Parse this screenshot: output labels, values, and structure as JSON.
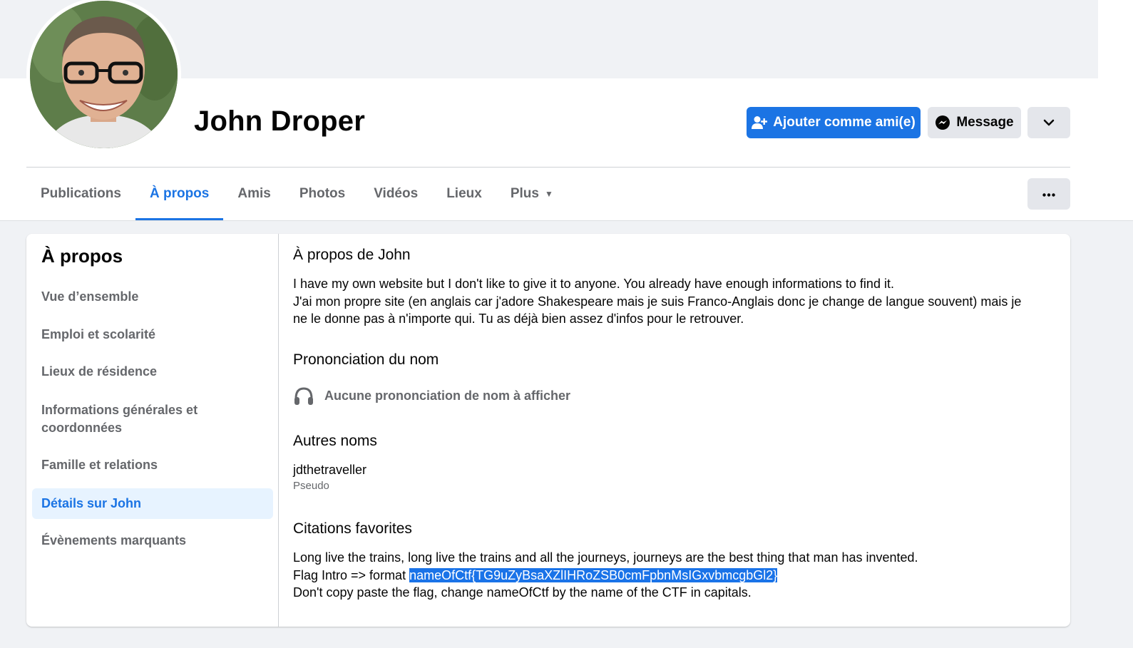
{
  "profile": {
    "name": "John Droper"
  },
  "actions": {
    "add_friend": "Ajouter comme ami(e)",
    "message": "Message"
  },
  "tabs": [
    {
      "label": "Publications"
    },
    {
      "label": "À propos"
    },
    {
      "label": "Amis"
    },
    {
      "label": "Photos"
    },
    {
      "label": "Vidéos"
    },
    {
      "label": "Lieux"
    },
    {
      "label": "Plus"
    }
  ],
  "sidebar": {
    "title": "À propos",
    "items": [
      {
        "label": "Vue d’ensemble"
      },
      {
        "label": "Emploi et scolarité"
      },
      {
        "label": "Lieux de résidence"
      },
      {
        "label": "Informations générales et coordonnées"
      },
      {
        "label": "Famille et relations"
      },
      {
        "label": "Détails sur John"
      },
      {
        "label": "Évènements marquants"
      }
    ]
  },
  "details": {
    "about_title": "À propos de John",
    "about_line1": "I have my own website but I don't like to give it to anyone. You already have enough informations to find it.",
    "about_line2": "J'ai mon propre site (en anglais car j'adore Shakespeare mais je suis Franco-Anglais donc je change de langue souvent) mais je",
    "about_line3": "ne le donne pas à n'importe qui. Tu as déjà bien assez d'infos pour le retrouver.",
    "pron_title": "Prononciation du nom",
    "pron_text": "Aucune prononciation de nom à afficher",
    "other_names_title": "Autres noms",
    "other_name_value": "jdthetraveller",
    "other_name_type": "Pseudo",
    "quotes_title": "Citations favorites",
    "quote_line1": "Long live the trains, long live the trains and all the journeys, journeys are the best thing that man has invented.",
    "quote_line2_prefix": "Flag Intro => format ",
    "quote_line2_flag": "nameOfCtf{TG9uZyBsaXZlIHRoZSB0cmFpbnMsIGxvbmcgbGl2}",
    "quote_line3": "Don't copy paste the flag, change nameOfCtf by the name of the CTF in capitals."
  },
  "colors": {
    "accent": "#1b74e4",
    "selection": "#1a73e8",
    "page_bg": "#f0f2f5"
  }
}
